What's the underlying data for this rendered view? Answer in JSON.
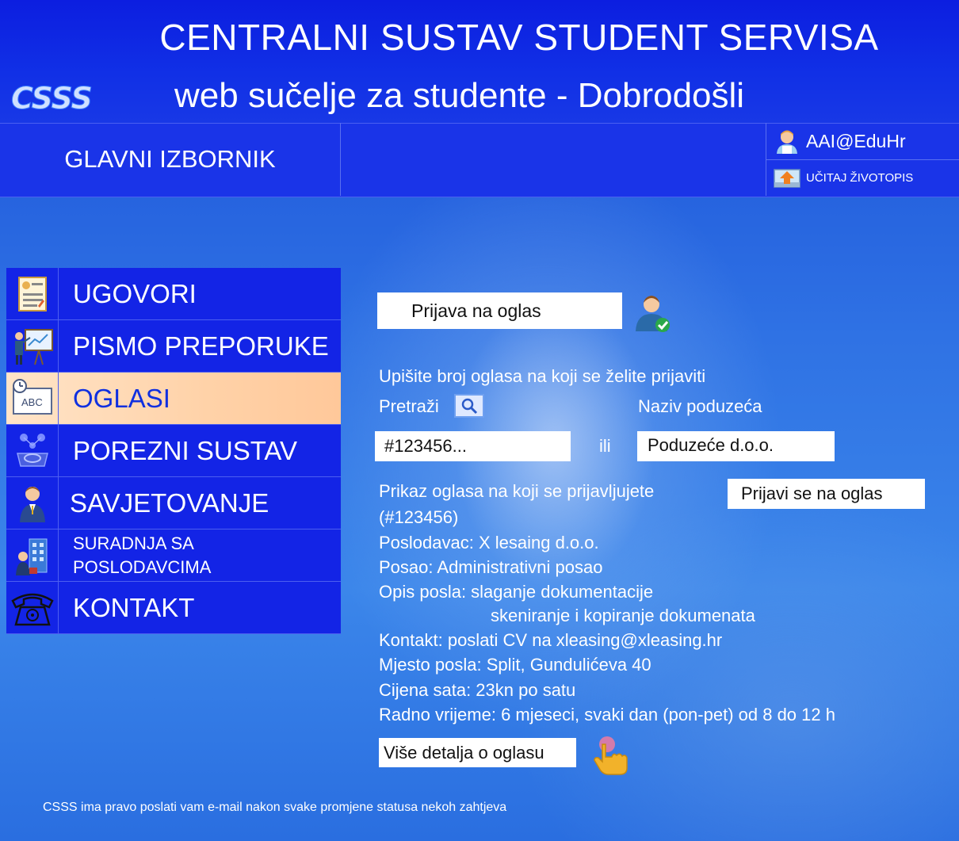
{
  "header": {
    "title": "CENTRALNI SUSTAV STUDENT SERVISA",
    "subtitle": "web sučelje za studente - Dobrodošli",
    "logo": "CSSS"
  },
  "menubar": {
    "main_menu_label": "GLAVNI IZBORNIK",
    "aai_label": "AAI@EduHr",
    "upload_cv_label": "UČITAJ ŽIVOTOPIS"
  },
  "sidebar": {
    "items": [
      {
        "label": "UGOVORI",
        "icon": "contract-icon",
        "active": false
      },
      {
        "label": "PISMO PREPORUKE",
        "icon": "presentation-icon",
        "active": false
      },
      {
        "label": "OGLASI",
        "icon": "ad-board-icon",
        "active": true
      },
      {
        "label": "POREZNI SUSTAV",
        "icon": "tax-money-icon",
        "active": false
      },
      {
        "label": "SAVJETOVANJE",
        "icon": "advisor-icon",
        "active": false
      },
      {
        "label": "SURADNJA SA POSLODAVCIMA",
        "line1": "SURADNJA SA",
        "line2": "POSLODAVCIMA",
        "icon": "employer-building-icon",
        "active": false
      },
      {
        "label": "KONTAKT",
        "icon": "telephone-icon",
        "active": false
      }
    ]
  },
  "content": {
    "heading": "Prijava na oglas",
    "instruction": "Upišite broj oglasa na koji se želite prijaviti",
    "search_label": "Pretraži",
    "company_label": "Naziv poduzeća",
    "search_input_value": "#123456...",
    "or_label": "ili",
    "company_input_value": "Poduzeće d.o.o.",
    "preview_line1": "Prikaz oglasa na koji se prijavljujete",
    "preview_line2": "(#123456)",
    "apply_button": "Prijavi se na oglas",
    "employer": "Poslodavac: X lesaing d.o.o.",
    "job": "Posao: Administrativni posao",
    "description_1": "Opis posla: slaganje dokumentacije",
    "description_2": "skeniranje i kopiranje dokumenata",
    "contact": "Kontakt: poslati CV na xleasing@xleasing.hr",
    "location": "Mjesto posla: Split, Gundulićeva 40",
    "hourly_rate": "Cijena sata: 23kn po satu",
    "work_time": "Radno vrijeme: 6 mjeseci, svaki dan (pon-pet) od 8 do 12 h",
    "more_details_button": "Više detalja o oglasu"
  },
  "footer": {
    "note": "CSSS ima pravo poslati vam e-mail nakon svake promjene statusa nekoh zahtjeva"
  }
}
